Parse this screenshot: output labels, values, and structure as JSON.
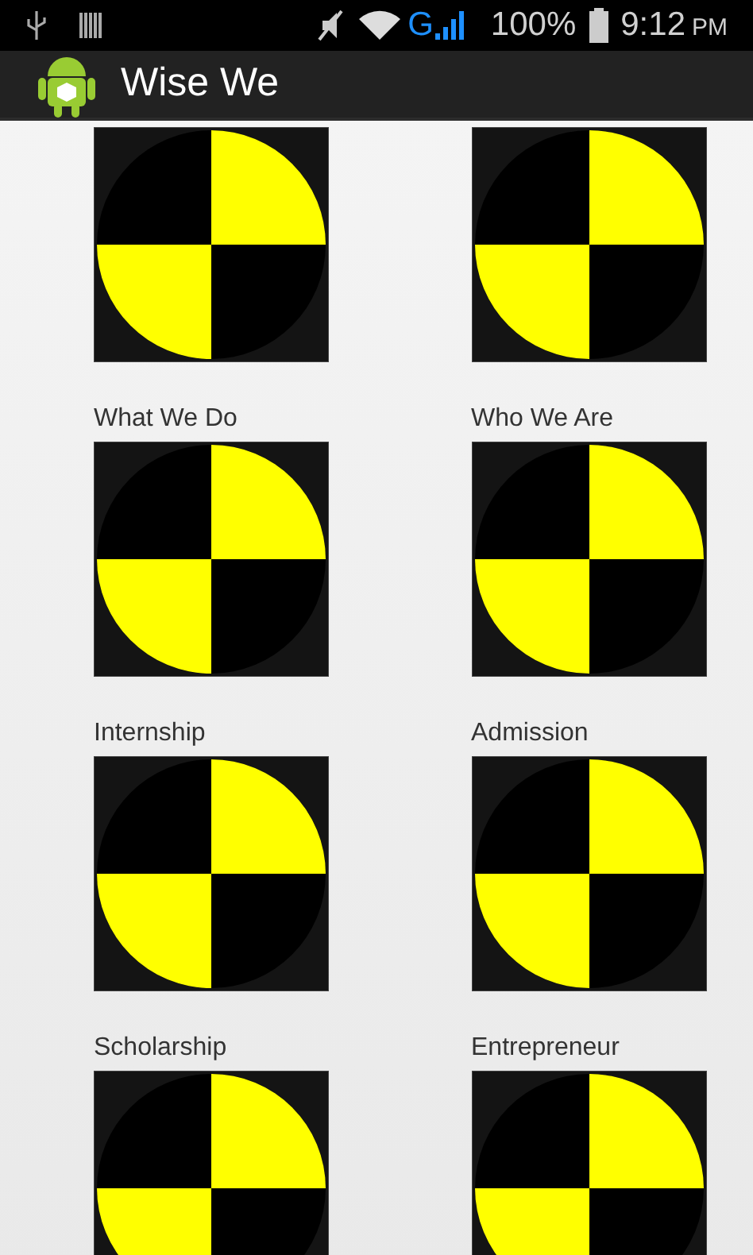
{
  "status_bar": {
    "network": "G",
    "battery": "100%",
    "time": "9:12",
    "meridiem": "PM"
  },
  "app_bar": {
    "title": "Wise We"
  },
  "grid": [
    {
      "kind": "tile",
      "label": "What We Do"
    },
    {
      "kind": "tile",
      "label": "Who We Are"
    },
    {
      "kind": "tile",
      "label": "Internship"
    },
    {
      "kind": "tile",
      "label": "Admission"
    },
    {
      "kind": "tile",
      "label": "Scholarship"
    },
    {
      "kind": "tile",
      "label": "Entrepreneur"
    },
    {
      "kind": "tile"
    },
    {
      "kind": "tile"
    }
  ]
}
